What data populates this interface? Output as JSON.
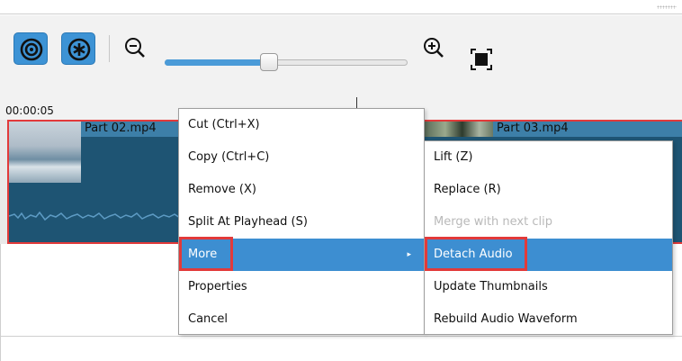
{
  "toolbar": {
    "buttons": [
      {
        "name": "snap",
        "icon": "target-icon",
        "active": true
      },
      {
        "name": "ripple",
        "icon": "asterisk-icon",
        "active": true
      }
    ],
    "zoom_out_icon": "zoom-out-icon",
    "zoom_in_icon": "zoom-in-icon",
    "fit_icon": "zoom-fit-icon",
    "zoom_level": 0.43
  },
  "ruler": {
    "timecode": "00:00:05"
  },
  "timeline": {
    "clips": [
      {
        "label": "Part 02.mp4",
        "selected": true
      },
      {
        "label": "Part 03.mp4",
        "selected": true
      }
    ]
  },
  "context_menu": {
    "items": [
      {
        "label": "Cut (Ctrl+X)"
      },
      {
        "label": "Copy (Ctrl+C)"
      },
      {
        "label": "Remove (X)"
      },
      {
        "label": "Split At Playhead (S)"
      },
      {
        "label": "More",
        "highlighted": true,
        "has_submenu": true
      },
      {
        "label": "Properties"
      },
      {
        "label": "Cancel"
      }
    ],
    "submenu_arrow": "▸"
  },
  "submenu": {
    "items": [
      {
        "label": "Lift (Z)"
      },
      {
        "label": "Replace (R)"
      },
      {
        "label": "Merge with next clip",
        "disabled": true
      },
      {
        "label": "Detach Audio",
        "highlighted": true
      },
      {
        "label": "Update Thumbnails"
      },
      {
        "label": "Rebuild Audio Waveform"
      }
    ]
  },
  "colors": {
    "accent": "#3d8ed1",
    "selection_outline": "#e23a3a",
    "clip_body": "#1e5473",
    "clip_header": "#3d7fa8"
  }
}
